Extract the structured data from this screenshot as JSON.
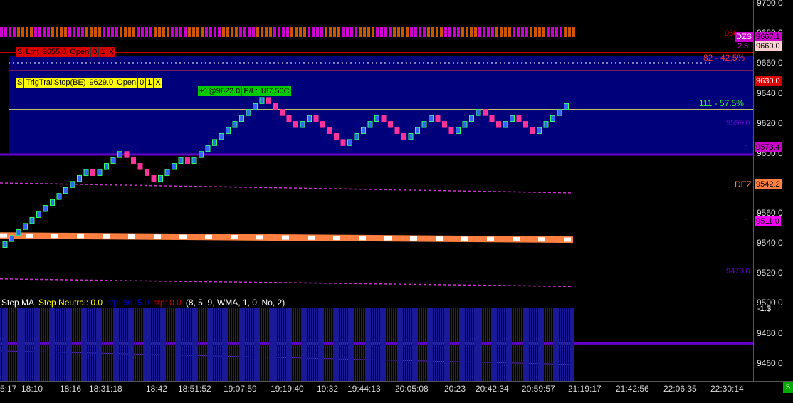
{
  "chart_data": {
    "type": "candlestick",
    "ylim": [
      9448,
      9702
    ],
    "y_ticks": [
      "9460.0",
      "9480.0",
      "9500.0",
      "9520.0",
      "9540.0",
      "9560.0",
      "9580.0",
      "9600.0",
      "9620.0",
      "9640.0",
      "9660.0",
      "9680.0",
      "9700.0"
    ],
    "x_ticks": [
      "5:17",
      "18:10",
      "18:16",
      "18:31:18",
      "18:42",
      "18:51:52",
      "19:07:59",
      "19:19:40",
      "19:32",
      "19:44:13",
      "20:05:08",
      "20:23",
      "20:42:34",
      "20:59:57",
      "21:19:17",
      "21:42:56",
      "22:06:35",
      "22:30:14"
    ],
    "bricks": [
      {
        "o": 9537,
        "c": 9541
      },
      {
        "o": 9541,
        "c": 9545
      },
      {
        "o": 9545,
        "c": 9549
      },
      {
        "o": 9549,
        "c": 9553
      },
      {
        "o": 9553,
        "c": 9557
      },
      {
        "o": 9557,
        "c": 9561
      },
      {
        "o": 9561,
        "c": 9565
      },
      {
        "o": 9565,
        "c": 9569
      },
      {
        "o": 9569,
        "c": 9573
      },
      {
        "o": 9573,
        "c": 9577
      },
      {
        "o": 9577,
        "c": 9581
      },
      {
        "o": 9581,
        "c": 9585
      },
      {
        "o": 9585,
        "c": 9589
      },
      {
        "o": 9589,
        "c": 9585
      },
      {
        "o": 9585,
        "c": 9589
      },
      {
        "o": 9589,
        "c": 9593
      },
      {
        "o": 9593,
        "c": 9597
      },
      {
        "o": 9597,
        "c": 9601
      },
      {
        "o": 9601,
        "c": 9597
      },
      {
        "o": 9597,
        "c": 9593
      },
      {
        "o": 9593,
        "c": 9589
      },
      {
        "o": 9589,
        "c": 9585
      },
      {
        "o": 9585,
        "c": 9581
      },
      {
        "o": 9581,
        "c": 9585
      },
      {
        "o": 9585,
        "c": 9589
      },
      {
        "o": 9589,
        "c": 9593
      },
      {
        "o": 9593,
        "c": 9597
      },
      {
        "o": 9597,
        "c": 9593
      },
      {
        "o": 9593,
        "c": 9597
      },
      {
        "o": 9597,
        "c": 9601
      },
      {
        "o": 9601,
        "c": 9605
      },
      {
        "o": 9605,
        "c": 9609
      },
      {
        "o": 9609,
        "c": 9613
      },
      {
        "o": 9613,
        "c": 9617
      },
      {
        "o": 9617,
        "c": 9621
      },
      {
        "o": 9621,
        "c": 9625
      },
      {
        "o": 9625,
        "c": 9629
      },
      {
        "o": 9629,
        "c": 9633
      },
      {
        "o": 9633,
        "c": 9637
      },
      {
        "o": 9637,
        "c": 9633
      },
      {
        "o": 9633,
        "c": 9629
      },
      {
        "o": 9629,
        "c": 9625
      },
      {
        "o": 9625,
        "c": 9621
      },
      {
        "o": 9621,
        "c": 9617
      },
      {
        "o": 9617,
        "c": 9621
      },
      {
        "o": 9621,
        "c": 9625
      },
      {
        "o": 9625,
        "c": 9621
      },
      {
        "o": 9621,
        "c": 9617
      },
      {
        "o": 9617,
        "c": 9613
      },
      {
        "o": 9613,
        "c": 9609
      },
      {
        "o": 9609,
        "c": 9605
      },
      {
        "o": 9605,
        "c": 9609
      },
      {
        "o": 9609,
        "c": 9613
      },
      {
        "o": 9613,
        "c": 9617
      },
      {
        "o": 9617,
        "c": 9621
      },
      {
        "o": 9621,
        "c": 9625
      },
      {
        "o": 9625,
        "c": 9621
      },
      {
        "o": 9621,
        "c": 9617
      },
      {
        "o": 9617,
        "c": 9613
      },
      {
        "o": 9613,
        "c": 9609
      },
      {
        "o": 9609,
        "c": 9613
      },
      {
        "o": 9613,
        "c": 9617
      },
      {
        "o": 9617,
        "c": 9621
      },
      {
        "o": 9621,
        "c": 9625
      },
      {
        "o": 9625,
        "c": 9621
      },
      {
        "o": 9621,
        "c": 9617
      },
      {
        "o": 9617,
        "c": 9613
      },
      {
        "o": 9613,
        "c": 9617
      },
      {
        "o": 9617,
        "c": 9621
      },
      {
        "o": 9621,
        "c": 9625
      },
      {
        "o": 9625,
        "c": 9629
      },
      {
        "o": 9629,
        "c": 9625
      },
      {
        "o": 9625,
        "c": 9621
      },
      {
        "o": 9621,
        "c": 9617
      },
      {
        "o": 9617,
        "c": 9621
      },
      {
        "o": 9621,
        "c": 9625
      },
      {
        "o": 9625,
        "c": 9621
      },
      {
        "o": 9621,
        "c": 9617
      },
      {
        "o": 9617,
        "c": 9613
      },
      {
        "o": 9613,
        "c": 9617
      },
      {
        "o": 9617,
        "c": 9621
      },
      {
        "o": 9621,
        "c": 9625
      },
      {
        "o": 9625,
        "c": 9629
      },
      {
        "o": 9629,
        "c": 9633
      }
    ],
    "series": [
      {
        "name": "DEZ",
        "values_start": 9545,
        "values_end": 9542.2
      },
      {
        "value_start": 9575,
        "value_end": 9573.4
      },
      {
        "value_start": 9516,
        "value_end": 9511.0
      },
      {
        "value_start": 9468,
        "value_end": 9459
      }
    ],
    "levels": {
      "upper_band": 9665,
      "level_9655": 9655,
      "lower_band": 9599,
      "band_9473": 9473,
      "sr_top": 9667.1,
      "sr_bottom": 9599.0
    }
  },
  "price_labels": {
    "p9667": "9667.1",
    "p9667_left": "966",
    "dzs": "DZS",
    "p9660": "9660.0",
    "v25": "2.5",
    "p9630": "9630.0",
    "p9599": "9599.0",
    "p9573": "9573.4",
    "p9542": "9542.2",
    "p9511": "9511.0",
    "p9473": "9473.0",
    "dollar": "-1.$",
    "dez": "DEZ",
    "one_a": "1",
    "one_b": "1"
  },
  "stats": {
    "upper": "82 - 42.5%",
    "lower": "111 - 57.5%"
  },
  "orders": {
    "limit": {
      "side": "S",
      "type": "Lmt",
      "price": "9655.0",
      "state": "Open",
      "f": "0",
      "q": "1",
      "x": "X"
    },
    "trail": {
      "side": "S",
      "type": "TrigTrailStop(BE)",
      "price": "9629.0",
      "state": "Open",
      "f": "0",
      "q": "1",
      "x": "X"
    },
    "position": "+1@9622.0",
    "pnl": "P/L: 187.50C"
  },
  "indicator": {
    "name": "Step MA",
    "neutral": "Step Neutral: 0.0",
    "stp_blue": "stp: 9615.0",
    "stp_red": "stp: 0.0",
    "params": "(8, 5, 9, WMA, 1, 0, No, 2)"
  },
  "corner": "5",
  "colors": {
    "up": "#33ff66",
    "down": "#ff3399",
    "band": "#000080",
    "dez": "#ff8040",
    "magenta": "#cc00cc",
    "purple": "#6600cc"
  }
}
